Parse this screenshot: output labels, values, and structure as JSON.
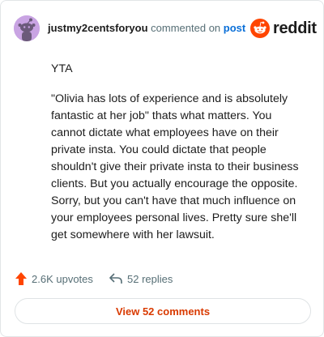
{
  "header": {
    "username": "justmy2centsforyou",
    "commented_on": "commented on",
    "post_link": "post",
    "brand": "reddit"
  },
  "comment": {
    "paragraphs": [
      "YTA",
      "\"Olivia has lots of experience and is absolutely fantastic at her job\" thats what matters. You cannot dictate what employees have on their private insta. You could dictate that people shouldn't give their private insta to their business clients. But you actually encourage the opposite. Sorry, but you can't have that much influence on your employees personal lives. Pretty sure she'll get somewhere with her lawsuit."
    ]
  },
  "stats": {
    "upvotes": "2.6K upvotes",
    "replies": "52 replies"
  },
  "actions": {
    "view_comments": "View 52 comments"
  },
  "colors": {
    "upvote": "#ff4500",
    "link": "#0a6fd8",
    "button_text": "#d93a00",
    "avatar_bg": "#c9a4e3"
  }
}
